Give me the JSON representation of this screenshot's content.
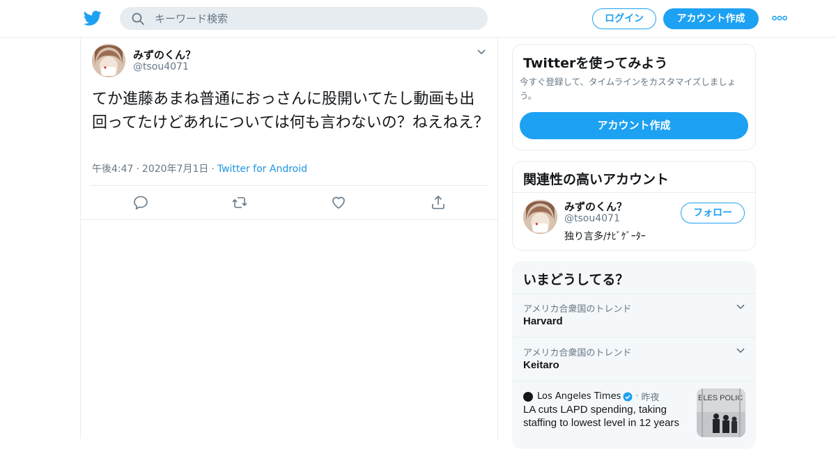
{
  "header": {
    "search_placeholder": "キーワード検索",
    "login_label": "ログイン",
    "signup_label": "アカウント作成"
  },
  "tweet": {
    "display_name": "みずのくん？",
    "handle": "@tsou4071",
    "text": "てか進藤あまね普通におっさんに股開いてたし動画も出回ってたけどあれについては何も言わないの？ねえねえ？",
    "time": "午後4:47",
    "date": "2020年7月1日",
    "source": "Twitter for Android"
  },
  "sidebar": {
    "signup_card": {
      "title": "Twitterを使ってみよう",
      "description": "今すぐ登録して、タイムラインをカスタマイズしましょう。",
      "button_label": "アカウント作成"
    },
    "related": {
      "title": "関連性の高いアカウント",
      "display_name": "みずのくん？",
      "handle": "@tsou4071",
      "bio": "独り言多/ﾅﾋﾞｹﾞｰﾀｰ",
      "follow_label": "フォロー"
    },
    "trends": {
      "title": "いまどうしてる？",
      "items": [
        {
          "context": "アメリカ合衆国のトレンド",
          "name": "Harvard"
        },
        {
          "context": "アメリカ合衆国のトレンド",
          "name": "Keitaro"
        }
      ],
      "news": {
        "source": "Los Angeles Times",
        "time": "昨夜",
        "title": "LA cuts LAPD spending, taking staffing to lowest level in 12 years",
        "thumb_text": "ELES POLIC"
      }
    }
  },
  "colors": {
    "accent": "#1da1f2",
    "link": "#1b95e0",
    "secondary_text": "#657786",
    "border": "#e6ecf0"
  }
}
